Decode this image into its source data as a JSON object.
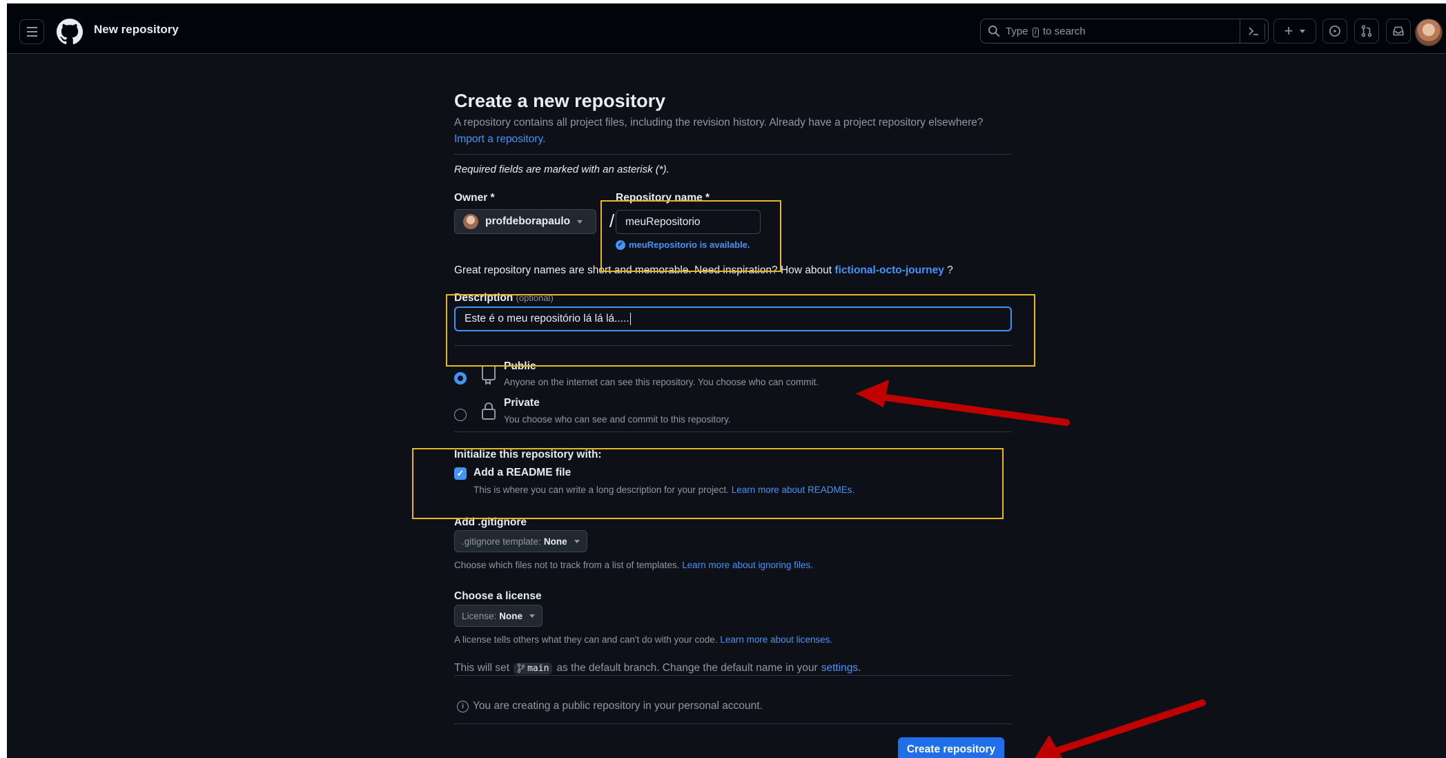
{
  "header": {
    "context_title": "New repository",
    "search_placeholder_before": "Type",
    "search_slash": "/",
    "search_placeholder_after": "to search"
  },
  "page": {
    "title": "Create a new repository",
    "intro": "A repository contains all project files, including the revision history. Already have a project repository elsewhere?",
    "import_link": "Import a repository.",
    "required_note": "Required fields are marked with an asterisk (*)."
  },
  "owner": {
    "label": "Owner *",
    "value": "profdeborapaulo"
  },
  "repo_name": {
    "label": "Repository name *",
    "value": "meuRepositorio",
    "availability": "meuRepositorio is available."
  },
  "suggestion": {
    "text": "Great repository names are short and memorable. Need inspiration? How about",
    "name": "fictional-octo-journey",
    "suffix": "?"
  },
  "description": {
    "label": "Description",
    "optional": "(optional)",
    "value": "Este é o meu repositório lá lá lá....."
  },
  "visibility": {
    "public_title": "Public",
    "public_desc": "Anyone on the internet can see this repository. You choose who can commit.",
    "private_title": "Private",
    "private_desc": "You choose who can see and commit to this repository.",
    "selected": "public"
  },
  "initialize": {
    "heading": "Initialize this repository with:",
    "readme_label": "Add a README file",
    "readme_checked": true,
    "readme_desc": "This is where you can write a long description for your project.",
    "readme_link": "Learn more about READMEs."
  },
  "gitignore": {
    "label": "Add .gitignore",
    "select_prefix": ".gitignore template:",
    "select_value": "None",
    "desc": "Choose which files not to track from a list of templates.",
    "link": "Learn more about ignoring files."
  },
  "license": {
    "label": "Choose a license",
    "select_prefix": "License:",
    "select_value": "None",
    "desc": "A license tells others what they can and can't do with your code.",
    "link": "Learn more about licenses."
  },
  "branch": {
    "before": "This will set",
    "name": "main",
    "after": "as the default branch. Change the default name in your",
    "link": "settings",
    "end": "."
  },
  "info": "You are creating a public repository in your personal account.",
  "create_button": "Create repository",
  "colors": {
    "bg": "#0d1117",
    "header_bg": "#010409",
    "link": "#4493f8",
    "primary_button": "#1f6feb",
    "highlight": "#e9b720",
    "annotation_arrow": "#c00000"
  }
}
